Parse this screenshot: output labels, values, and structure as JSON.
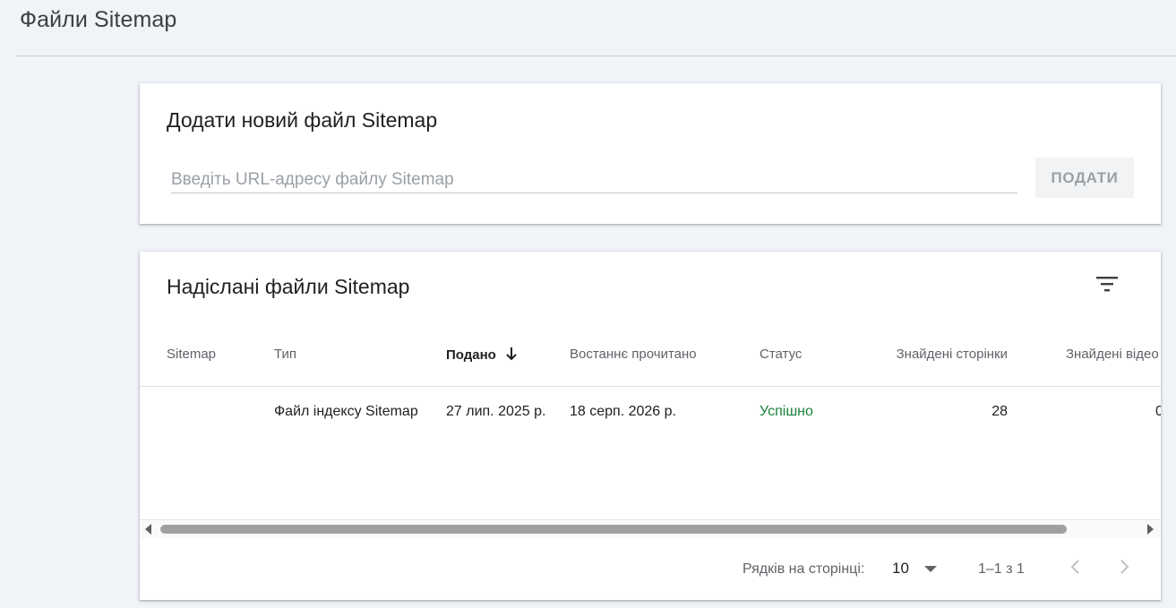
{
  "page": {
    "title": "Файли Sitemap"
  },
  "add_card": {
    "title": "Додати новий файл Sitemap",
    "input_placeholder": "Введіть URL-адресу файлу Sitemap",
    "input_value": "",
    "submit_label": "ПОДАТИ"
  },
  "list_card": {
    "title": "Надіслані файли Sitemap",
    "columns": {
      "sitemap": "Sitemap",
      "type": "Тип",
      "submitted": "Подано",
      "last_read": "Востаннє прочитано",
      "status": "Статус",
      "pages_found": "Знайдені сторінки",
      "videos_found": "Знайдені відео"
    },
    "sorted_column": "submitted",
    "rows": [
      {
        "sitemap": "",
        "type": "Файл індексу Sitemap",
        "submitted": "27 лип. 2025 р.",
        "last_read": "18 серп. 2026 р.",
        "status": "Успішно",
        "pages_found": "28",
        "videos_found": "0"
      }
    ],
    "pagination": {
      "rows_per_page_label": "Рядків на сторінці:",
      "rows_per_page_value": "10",
      "range": "1–1 з 1"
    }
  },
  "colors": {
    "status_success": "#188038",
    "text_secondary": "#5f6368",
    "page_bg": "#f0f3f8"
  },
  "icons": {
    "filter": "filter-icon",
    "sort": "arrow-down-icon",
    "dropdown": "dropdown-arrow-icon",
    "prev": "chevron-left-icon",
    "next": "chevron-right-icon"
  }
}
